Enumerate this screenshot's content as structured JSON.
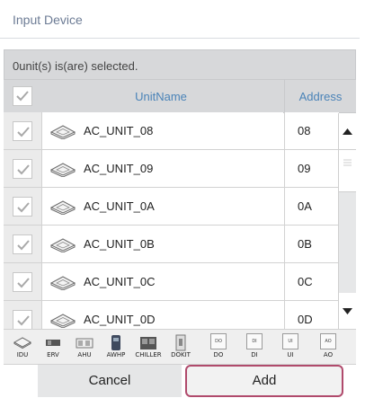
{
  "window": {
    "title": "Input Device"
  },
  "status": {
    "text": "0unit(s) is(are) selected."
  },
  "table": {
    "columns": {
      "name": "UnitName",
      "address": "Address"
    },
    "rows": [
      {
        "name": "AC_UNIT_08",
        "address": "08",
        "checked": true
      },
      {
        "name": "AC_UNIT_09",
        "address": "09",
        "checked": true
      },
      {
        "name": "AC_UNIT_0A",
        "address": "0A",
        "checked": true
      },
      {
        "name": "AC_UNIT_0B",
        "address": "0B",
        "checked": true
      },
      {
        "name": "AC_UNIT_0C",
        "address": "0C",
        "checked": true
      },
      {
        "name": "AC_UNIT_0D",
        "address": "0D",
        "checked": true
      }
    ]
  },
  "filters": [
    {
      "label": "IDU",
      "icon": "idu-icon"
    },
    {
      "label": "ERV",
      "icon": "erv-icon"
    },
    {
      "label": "AHU",
      "icon": "ahu-icon"
    },
    {
      "label": "AWHP",
      "icon": "awhp-icon"
    },
    {
      "label": "CHILLER",
      "icon": "chiller-icon"
    },
    {
      "label": "DOKIT",
      "icon": "dokit-icon"
    },
    {
      "label": "DO",
      "icon": "do-icon",
      "tile": "DO"
    },
    {
      "label": "DI",
      "icon": "di-icon",
      "tile": "DI"
    },
    {
      "label": "UI",
      "icon": "ui-icon",
      "tile": "UI"
    },
    {
      "label": "AO",
      "icon": "ao-icon",
      "tile": "AO"
    }
  ],
  "buttons": {
    "cancel": "Cancel",
    "add": "Add"
  },
  "colors": {
    "header_text": "#4a83b8",
    "add_border": "#b04a6c",
    "title_text": "#6d7c95"
  }
}
